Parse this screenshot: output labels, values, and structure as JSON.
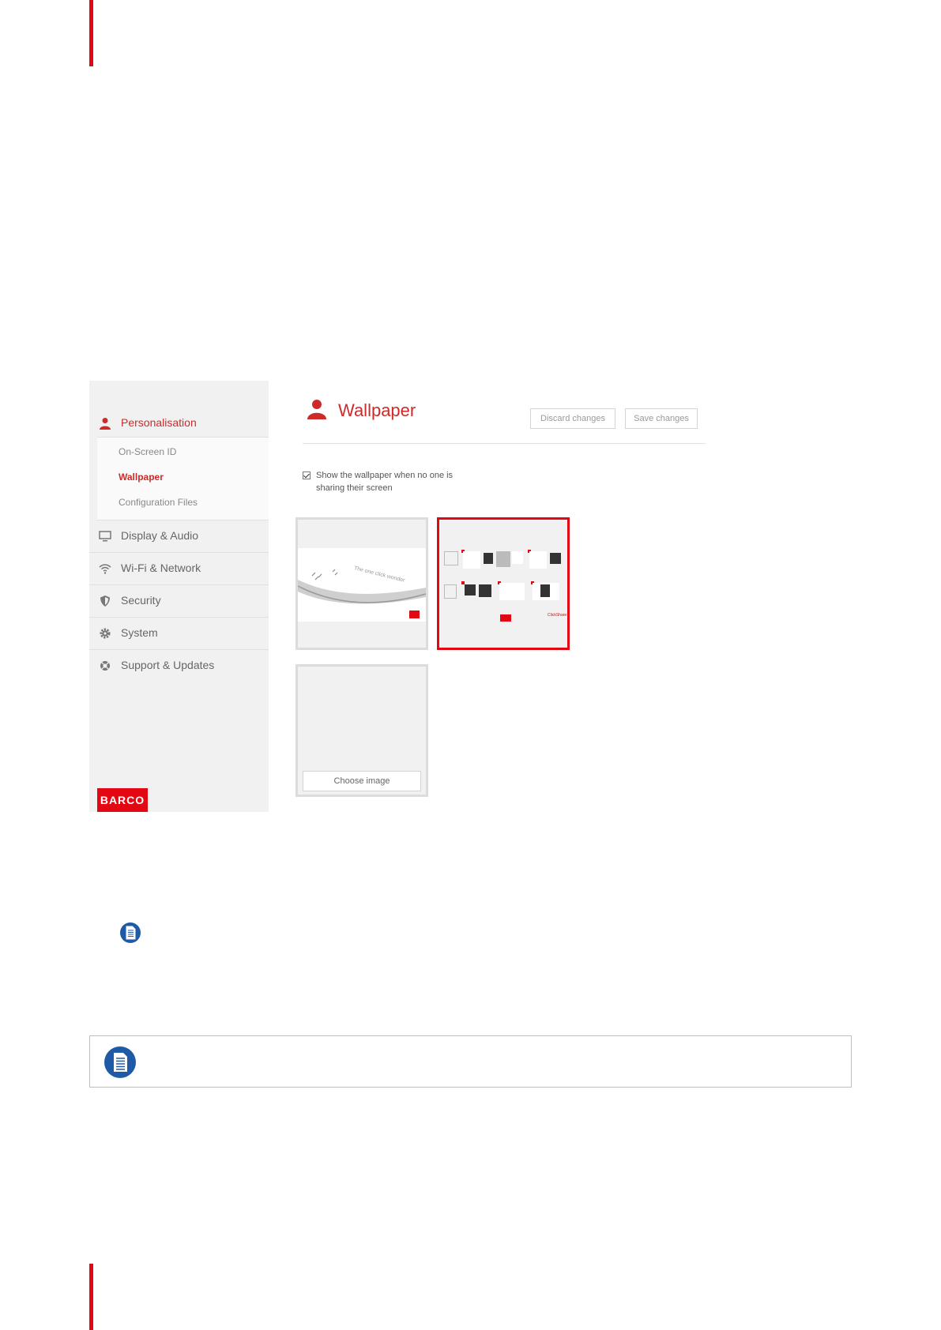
{
  "sidebar": {
    "heading": "Personalisation",
    "sub_items": [
      {
        "label": "On-Screen ID"
      },
      {
        "label": "Wallpaper"
      },
      {
        "label": "Configuration Files"
      }
    ],
    "items": [
      {
        "label": "Display & Audio",
        "icon": "monitor-icon"
      },
      {
        "label": "Wi-Fi & Network",
        "icon": "wifi-icon"
      },
      {
        "label": "Security",
        "icon": "shield-icon"
      },
      {
        "label": "System",
        "icon": "gear-icon"
      },
      {
        "label": "Support & Updates",
        "icon": "lifebuoy-icon"
      }
    ],
    "logo": "BARCO"
  },
  "main": {
    "title": "Wallpaper",
    "discard_label": "Discard changes",
    "save_label": "Save changes",
    "checkbox_label": "Show the wallpaper when no one is sharing their screen",
    "checkbox_checked": true,
    "choose_image_label": "Choose image",
    "tile1_text": "The one click wonder",
    "tile2_brand": "ClickShare"
  },
  "colors": {
    "accent": "#e30613",
    "active_text": "#cf2a2a",
    "note_icon": "#1f5aa6"
  }
}
